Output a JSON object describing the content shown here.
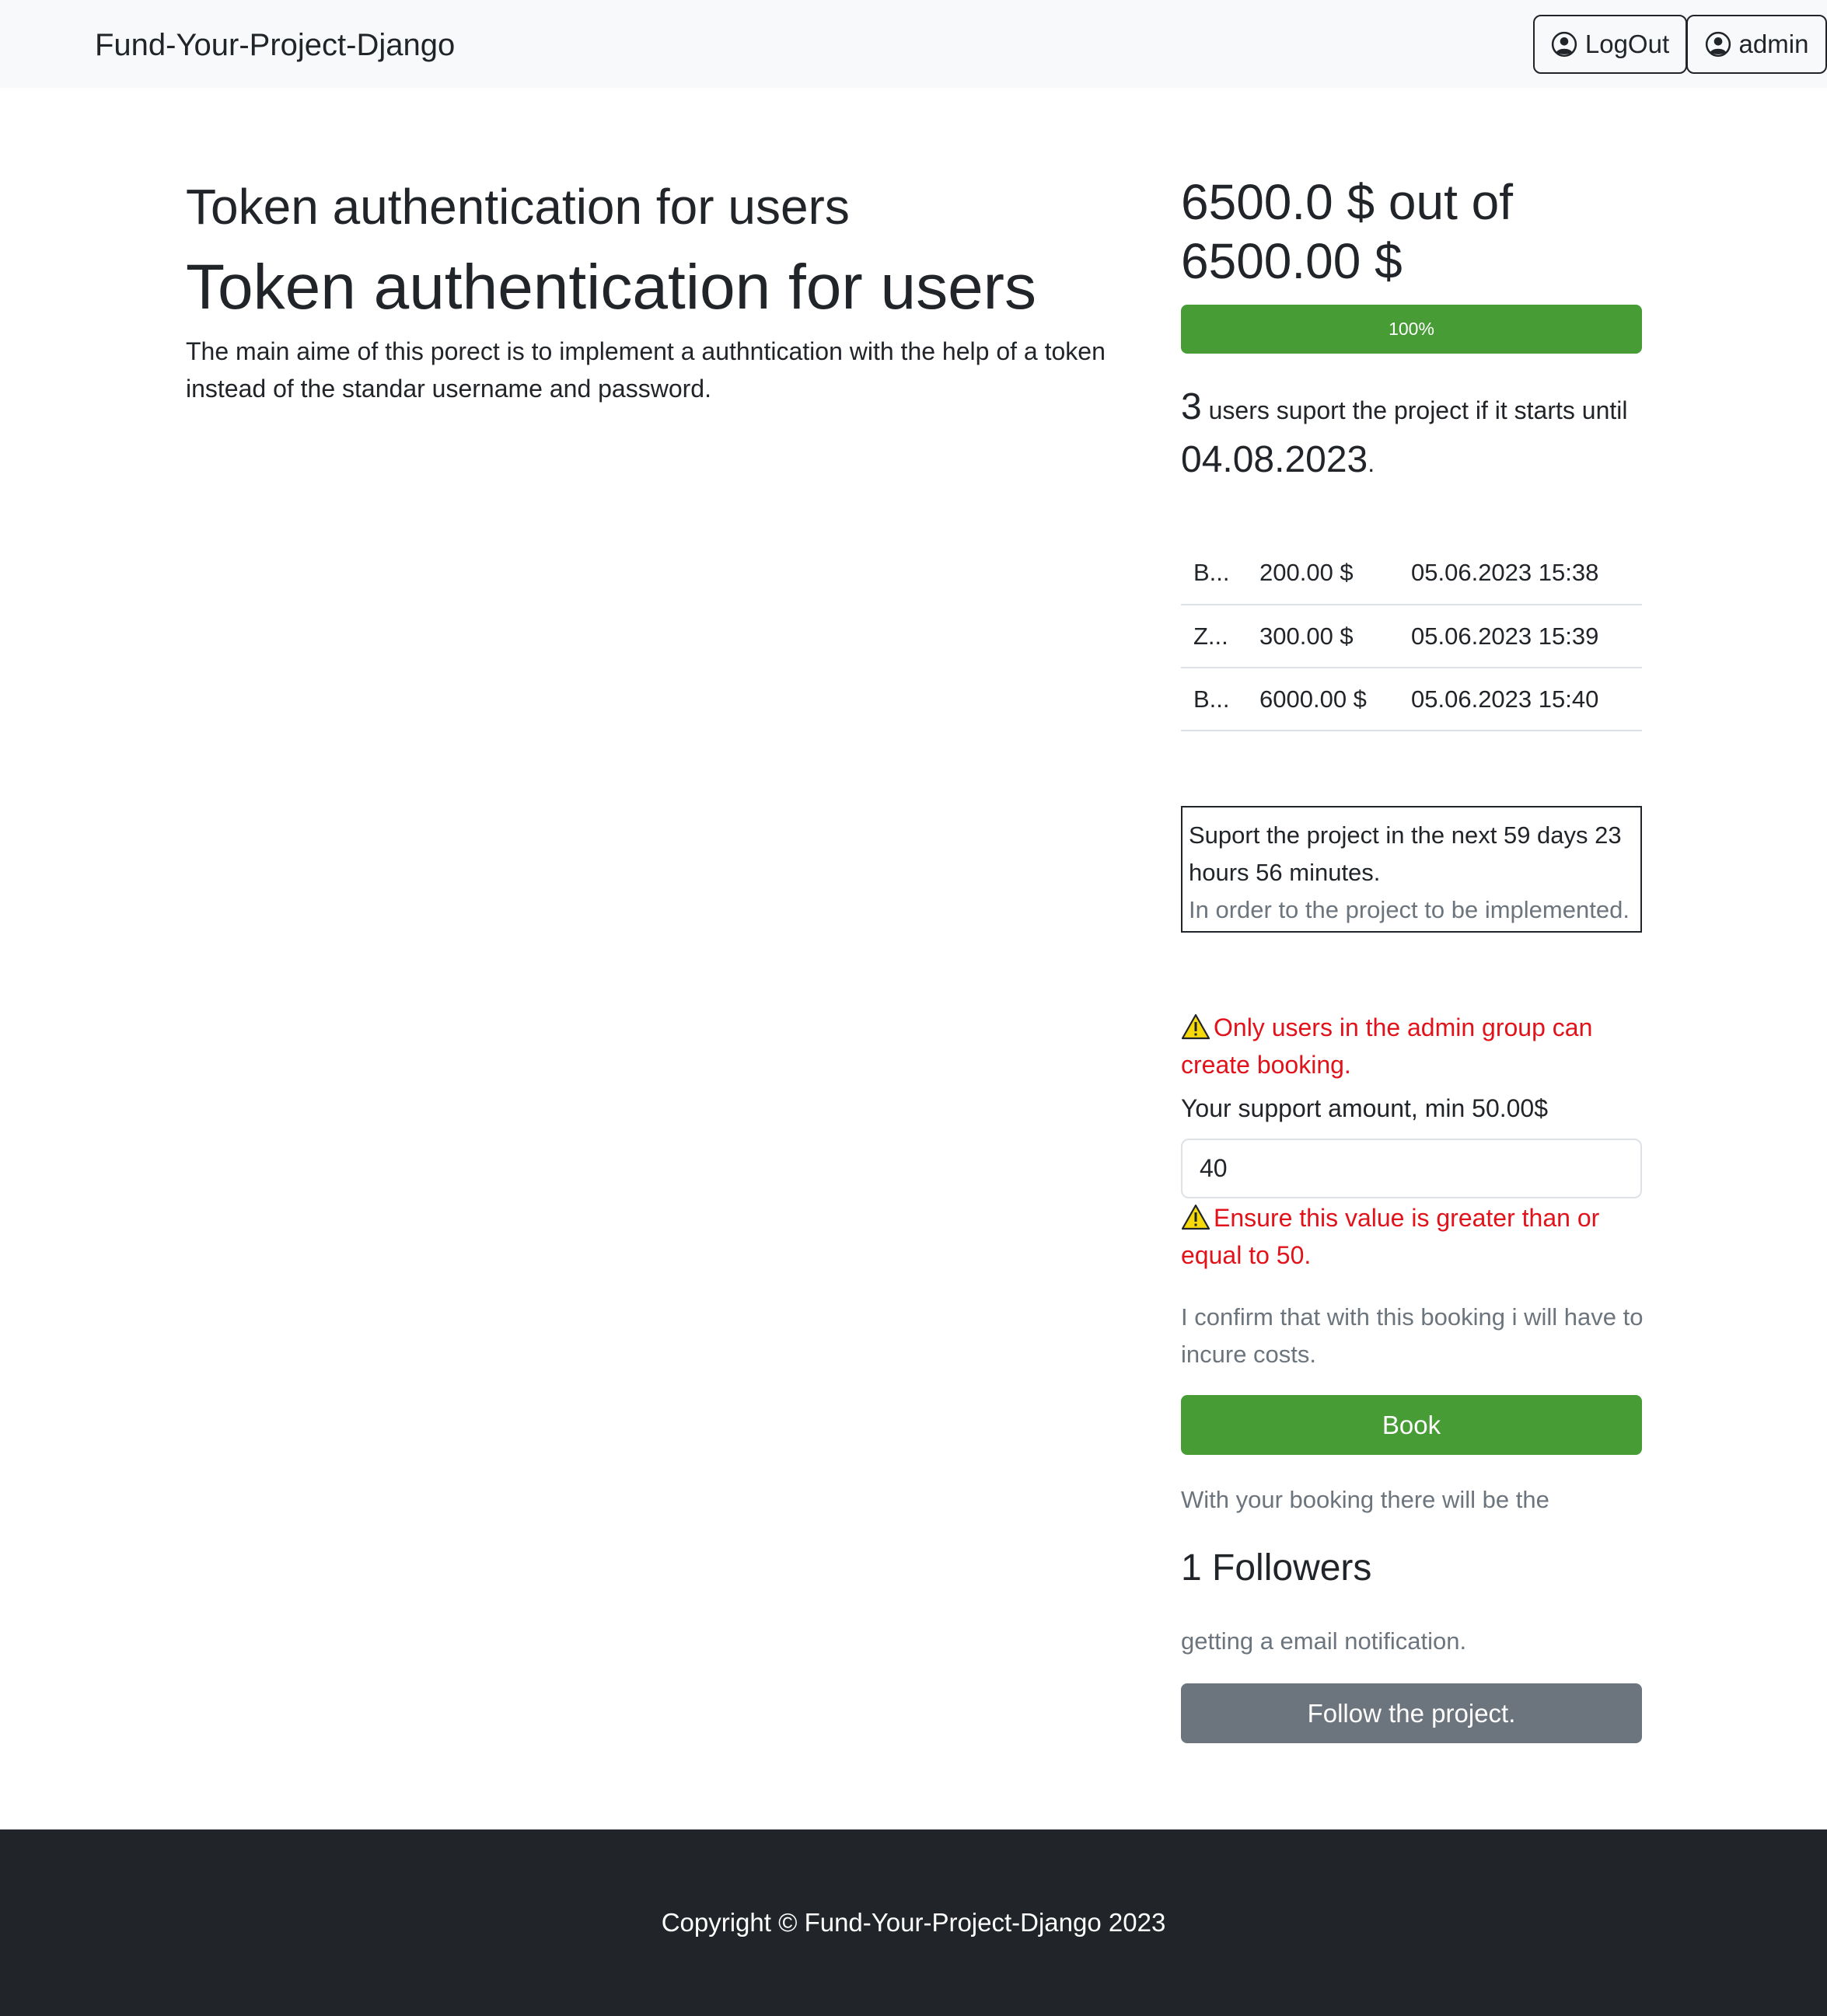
{
  "navbar": {
    "brand": "Fund-Your-Project-Django",
    "logout_label": "LogOut",
    "user_label": "admin",
    "icons": {
      "logout": "user-circle-icon",
      "user": "user-circle-icon"
    }
  },
  "project": {
    "title_small": "Token authentication for users",
    "title_large": "Token authentication for users",
    "description": "The main aime of this porect is to implement a authntication with the help of a token instead of the standar username and password."
  },
  "funding": {
    "amount_text": "6500.0 $ out of 6500.00 $",
    "progress_label": "100%",
    "progress_fraction": 1.0,
    "supporters_count": "3",
    "supporters_text": " users suport the project if it starts until ",
    "deadline": "04.08.2023",
    "deadline_suffix": "."
  },
  "bookings": [
    {
      "user": "B...",
      "amount": "200.00 $",
      "date": "05.06.2023 15:38"
    },
    {
      "user": "Z...",
      "amount": "300.00 $",
      "date": "05.06.2023 15:39"
    },
    {
      "user": "B...",
      "amount": "6000.00 $",
      "date": "05.06.2023 15:40"
    }
  ],
  "notice": {
    "time_left": "Suport the project in the next 59 days 23 hours 56 minutes.",
    "subtext": "In order to the project to be implemented."
  },
  "form": {
    "admin_warning": "Only users in the admin group can create booking.",
    "amount_label": "Your support amount, min 50.00$",
    "amount_value": "40",
    "validation_error": "Ensure this value is greater than or equal to 50.",
    "confirm_text": "I confirm that with this booking i will have to incure costs.",
    "book_label": "Book",
    "warning_icon": "warning-triangle-icon"
  },
  "followers": {
    "pre_text": "With your booking there will be the",
    "count_text": "1 Followers",
    "post_text": "getting a email notification.",
    "follow_label": "Follow the project."
  },
  "footer": {
    "copyright": "Copyright © Fund-Your-Project-Django 2023"
  },
  "colors": {
    "accent_green": "#479c35",
    "secondary_gray": "#6c757d",
    "error_red": "#e2121b",
    "navbar_bg": "#f8f9fa",
    "footer_bg": "#212529"
  }
}
